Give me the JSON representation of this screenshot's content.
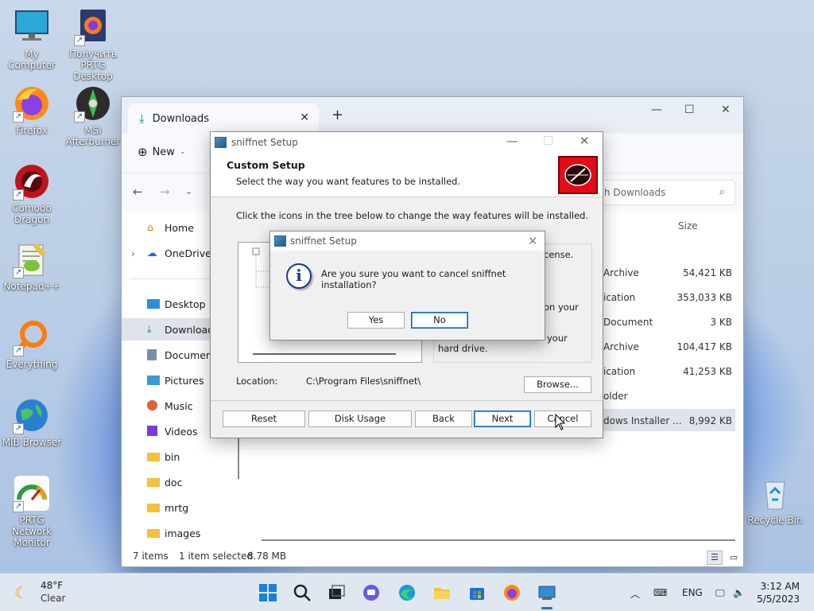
{
  "desktop": {
    "icons": [
      {
        "label": "My Computer"
      },
      {
        "label": "Получить PRTG Desktop"
      },
      {
        "label": "Firefox"
      },
      {
        "label": "MSI Afterburner"
      },
      {
        "label": "Comodo Dragon"
      },
      {
        "label": "Notepad++"
      },
      {
        "label": "Everything"
      },
      {
        "label": "MIB Browser"
      },
      {
        "label": "PRTG Network Monitor"
      },
      {
        "label": "Recycle Bin"
      }
    ]
  },
  "explorer": {
    "tab_title": "Downloads",
    "new_label": "New",
    "search_placeholder": "h Downloads",
    "column_size": "Size",
    "sidebar": [
      {
        "label": "Home"
      },
      {
        "label": "OneDrive"
      },
      {
        "label": "Desktop"
      },
      {
        "label": "Downloads"
      },
      {
        "label": "Documents"
      },
      {
        "label": "Pictures"
      },
      {
        "label": "Music"
      },
      {
        "label": "Videos"
      },
      {
        "label": "bin"
      },
      {
        "label": "doc"
      },
      {
        "label": "mrtg"
      },
      {
        "label": "images"
      }
    ],
    "files": [
      {
        "type": "Archive",
        "size": "54,421 KB"
      },
      {
        "type": "ication",
        "size": "353,033 KB"
      },
      {
        "type": "Document",
        "size": "3 KB"
      },
      {
        "type": "Archive",
        "size": "104,417 KB"
      },
      {
        "type": "ication",
        "size": "41,253 KB"
      },
      {
        "type": "older",
        "size": ""
      },
      {
        "type": "dows Installer ...",
        "size": "8,992 KB"
      }
    ],
    "status": {
      "items": "7 items",
      "selected": "1 item selected",
      "size": "8.78 MB"
    }
  },
  "setup": {
    "title": "sniffnet Setup",
    "banner_title": "Custom Setup",
    "banner_subtitle": "Select the way you want features to be installed.",
    "instruction": "Click the icons in the tree below to change the way features will be installed.",
    "desc_line1": "cense.",
    "desc_line2": "on your",
    "desc_line3": "your",
    "desc_line4": "hard drive.",
    "location_label": "Location:",
    "location_value": "C:\\Program Files\\sniffnet\\",
    "browse_label": "Browse...",
    "buttons": {
      "reset": "Reset",
      "disk_usage": "Disk Usage",
      "back": "Back",
      "next": "Next",
      "cancel": "Cancel"
    }
  },
  "confirm": {
    "title": "sniffnet Setup",
    "message": "Are you sure you want to cancel sniffnet installation?",
    "yes": "Yes",
    "no": "No"
  },
  "taskbar": {
    "temperature": "48°F",
    "weather": "Clear",
    "language": "ENG",
    "time": "3:12 AM",
    "date": "5/5/2023"
  }
}
